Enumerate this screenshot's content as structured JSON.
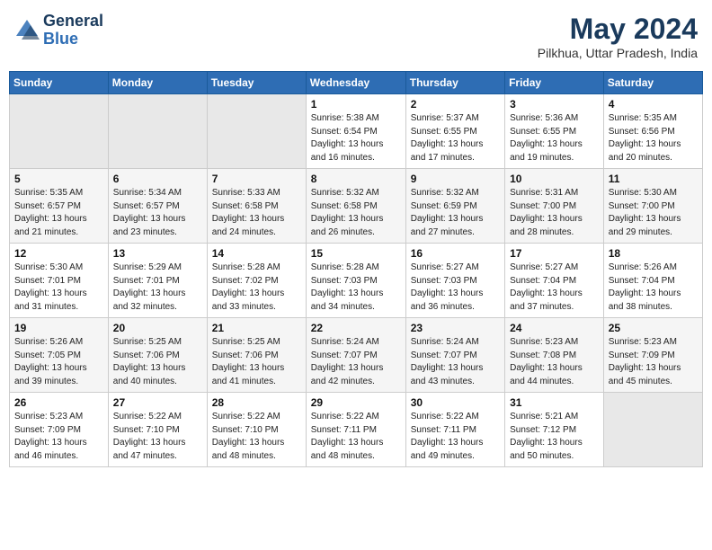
{
  "header": {
    "logo_general": "General",
    "logo_blue": "Blue",
    "month_year": "May 2024",
    "location": "Pilkhua, Uttar Pradesh, India"
  },
  "weekdays": [
    "Sunday",
    "Monday",
    "Tuesday",
    "Wednesday",
    "Thursday",
    "Friday",
    "Saturday"
  ],
  "weeks": [
    [
      {
        "day": "",
        "info": ""
      },
      {
        "day": "",
        "info": ""
      },
      {
        "day": "",
        "info": ""
      },
      {
        "day": "1",
        "info": "Sunrise: 5:38 AM\nSunset: 6:54 PM\nDaylight: 13 hours\nand 16 minutes."
      },
      {
        "day": "2",
        "info": "Sunrise: 5:37 AM\nSunset: 6:55 PM\nDaylight: 13 hours\nand 17 minutes."
      },
      {
        "day": "3",
        "info": "Sunrise: 5:36 AM\nSunset: 6:55 PM\nDaylight: 13 hours\nand 19 minutes."
      },
      {
        "day": "4",
        "info": "Sunrise: 5:35 AM\nSunset: 6:56 PM\nDaylight: 13 hours\nand 20 minutes."
      }
    ],
    [
      {
        "day": "5",
        "info": "Sunrise: 5:35 AM\nSunset: 6:57 PM\nDaylight: 13 hours\nand 21 minutes."
      },
      {
        "day": "6",
        "info": "Sunrise: 5:34 AM\nSunset: 6:57 PM\nDaylight: 13 hours\nand 23 minutes."
      },
      {
        "day": "7",
        "info": "Sunrise: 5:33 AM\nSunset: 6:58 PM\nDaylight: 13 hours\nand 24 minutes."
      },
      {
        "day": "8",
        "info": "Sunrise: 5:32 AM\nSunset: 6:58 PM\nDaylight: 13 hours\nand 26 minutes."
      },
      {
        "day": "9",
        "info": "Sunrise: 5:32 AM\nSunset: 6:59 PM\nDaylight: 13 hours\nand 27 minutes."
      },
      {
        "day": "10",
        "info": "Sunrise: 5:31 AM\nSunset: 7:00 PM\nDaylight: 13 hours\nand 28 minutes."
      },
      {
        "day": "11",
        "info": "Sunrise: 5:30 AM\nSunset: 7:00 PM\nDaylight: 13 hours\nand 29 minutes."
      }
    ],
    [
      {
        "day": "12",
        "info": "Sunrise: 5:30 AM\nSunset: 7:01 PM\nDaylight: 13 hours\nand 31 minutes."
      },
      {
        "day": "13",
        "info": "Sunrise: 5:29 AM\nSunset: 7:01 PM\nDaylight: 13 hours\nand 32 minutes."
      },
      {
        "day": "14",
        "info": "Sunrise: 5:28 AM\nSunset: 7:02 PM\nDaylight: 13 hours\nand 33 minutes."
      },
      {
        "day": "15",
        "info": "Sunrise: 5:28 AM\nSunset: 7:03 PM\nDaylight: 13 hours\nand 34 minutes."
      },
      {
        "day": "16",
        "info": "Sunrise: 5:27 AM\nSunset: 7:03 PM\nDaylight: 13 hours\nand 36 minutes."
      },
      {
        "day": "17",
        "info": "Sunrise: 5:27 AM\nSunset: 7:04 PM\nDaylight: 13 hours\nand 37 minutes."
      },
      {
        "day": "18",
        "info": "Sunrise: 5:26 AM\nSunset: 7:04 PM\nDaylight: 13 hours\nand 38 minutes."
      }
    ],
    [
      {
        "day": "19",
        "info": "Sunrise: 5:26 AM\nSunset: 7:05 PM\nDaylight: 13 hours\nand 39 minutes."
      },
      {
        "day": "20",
        "info": "Sunrise: 5:25 AM\nSunset: 7:06 PM\nDaylight: 13 hours\nand 40 minutes."
      },
      {
        "day": "21",
        "info": "Sunrise: 5:25 AM\nSunset: 7:06 PM\nDaylight: 13 hours\nand 41 minutes."
      },
      {
        "day": "22",
        "info": "Sunrise: 5:24 AM\nSunset: 7:07 PM\nDaylight: 13 hours\nand 42 minutes."
      },
      {
        "day": "23",
        "info": "Sunrise: 5:24 AM\nSunset: 7:07 PM\nDaylight: 13 hours\nand 43 minutes."
      },
      {
        "day": "24",
        "info": "Sunrise: 5:23 AM\nSunset: 7:08 PM\nDaylight: 13 hours\nand 44 minutes."
      },
      {
        "day": "25",
        "info": "Sunrise: 5:23 AM\nSunset: 7:09 PM\nDaylight: 13 hours\nand 45 minutes."
      }
    ],
    [
      {
        "day": "26",
        "info": "Sunrise: 5:23 AM\nSunset: 7:09 PM\nDaylight: 13 hours\nand 46 minutes."
      },
      {
        "day": "27",
        "info": "Sunrise: 5:22 AM\nSunset: 7:10 PM\nDaylight: 13 hours\nand 47 minutes."
      },
      {
        "day": "28",
        "info": "Sunrise: 5:22 AM\nSunset: 7:10 PM\nDaylight: 13 hours\nand 48 minutes."
      },
      {
        "day": "29",
        "info": "Sunrise: 5:22 AM\nSunset: 7:11 PM\nDaylight: 13 hours\nand 48 minutes."
      },
      {
        "day": "30",
        "info": "Sunrise: 5:22 AM\nSunset: 7:11 PM\nDaylight: 13 hours\nand 49 minutes."
      },
      {
        "day": "31",
        "info": "Sunrise: 5:21 AM\nSunset: 7:12 PM\nDaylight: 13 hours\nand 50 minutes."
      },
      {
        "day": "",
        "info": ""
      }
    ]
  ]
}
